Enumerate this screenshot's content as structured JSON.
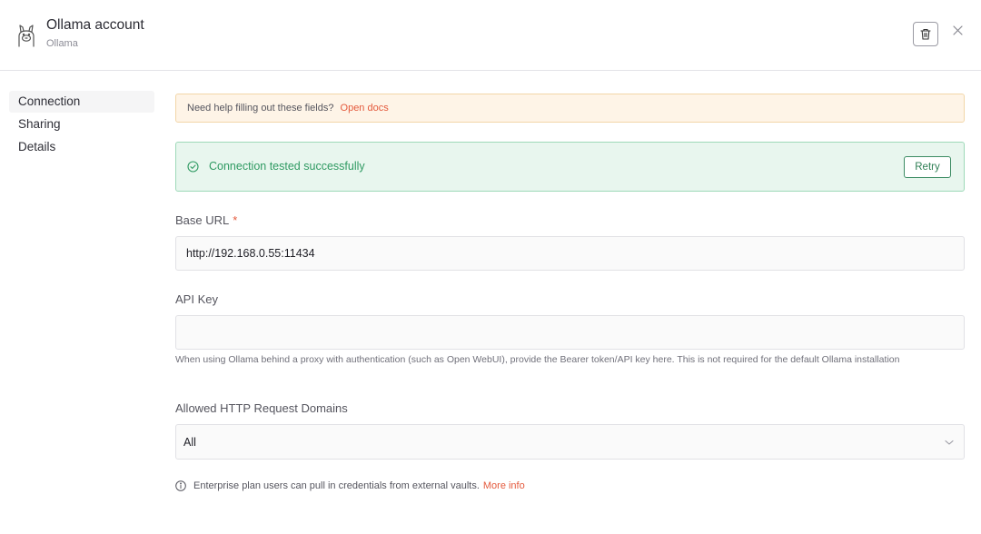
{
  "header": {
    "title": "Ollama account",
    "subtitle": "Ollama"
  },
  "sidebar": {
    "items": [
      {
        "label": "Connection",
        "active": true
      },
      {
        "label": "Sharing",
        "active": false
      },
      {
        "label": "Details",
        "active": false
      }
    ]
  },
  "notice": {
    "text": "Need help filling out these fields?",
    "link": "Open docs"
  },
  "status": {
    "text": "Connection tested successfully",
    "retry_label": "Retry"
  },
  "fields": {
    "base_url": {
      "label": "Base URL",
      "required_mark": "*",
      "value": "http://192.168.0.55:11434"
    },
    "api_key": {
      "label": "API Key",
      "value": "",
      "hint": "When using Ollama behind a proxy with authentication (such as Open WebUI), provide the Bearer token/API key here. This is not required for the default Ollama installation"
    },
    "allowed_domains": {
      "label": "Allowed HTTP Request Domains",
      "selected": "All"
    }
  },
  "info": {
    "text": "Enterprise plan users can pull in credentials from external vaults.",
    "link": "More info"
  },
  "icons": {
    "logo": "llama-icon",
    "delete": "trash-icon",
    "close": "close-icon",
    "success": "check-circle-icon",
    "dropdown": "chevron-down-icon",
    "info": "info-icon"
  },
  "colors": {
    "accent": "#e45a3d",
    "success": "#2f9a62",
    "success_bg": "#e8f6ee",
    "notice_bg": "#fef4e7"
  }
}
